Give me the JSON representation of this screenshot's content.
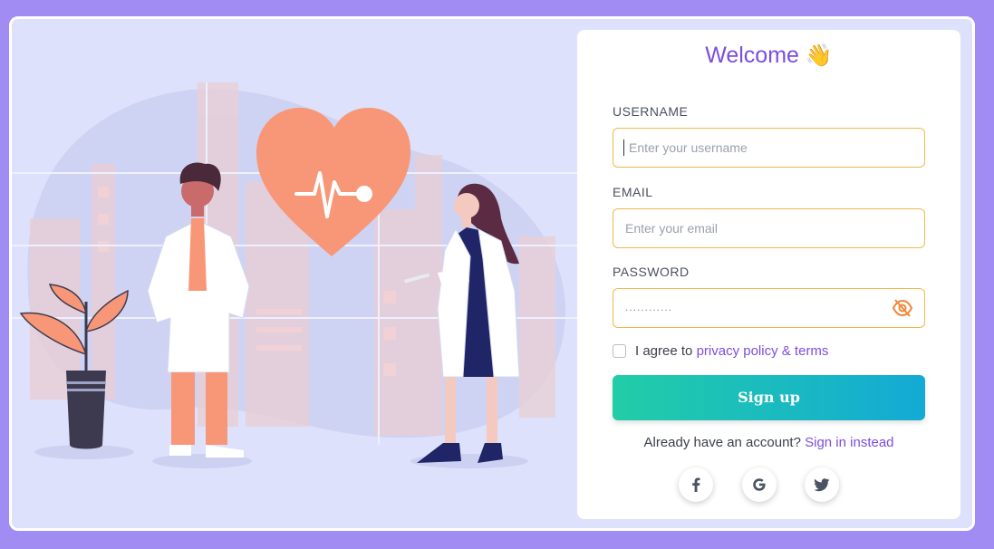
{
  "form": {
    "title": "Welcome",
    "title_emoji": "👋",
    "username": {
      "label": "USERNAME",
      "placeholder": "Enter your username"
    },
    "email": {
      "label": "EMAIL",
      "placeholder": "Enter your email"
    },
    "password": {
      "label": "PASSWORD",
      "value_masked": "............"
    },
    "agree_text": "I agree to",
    "agree_link": "privacy policy & terms",
    "submit_label": "Sign up",
    "already_text": "Already have an account?",
    "signin_link": "Sign in instead"
  },
  "social": [
    "facebook-icon",
    "google-icon",
    "twitter-icon"
  ],
  "colors": {
    "background": "#a08cf3",
    "panel": "#dde1fb",
    "accent": "#7c4dde",
    "input_border": "#f2b64c",
    "button_gradient": [
      "#22cda7",
      "#13aad5"
    ],
    "illustration_orange": "#f89777"
  }
}
